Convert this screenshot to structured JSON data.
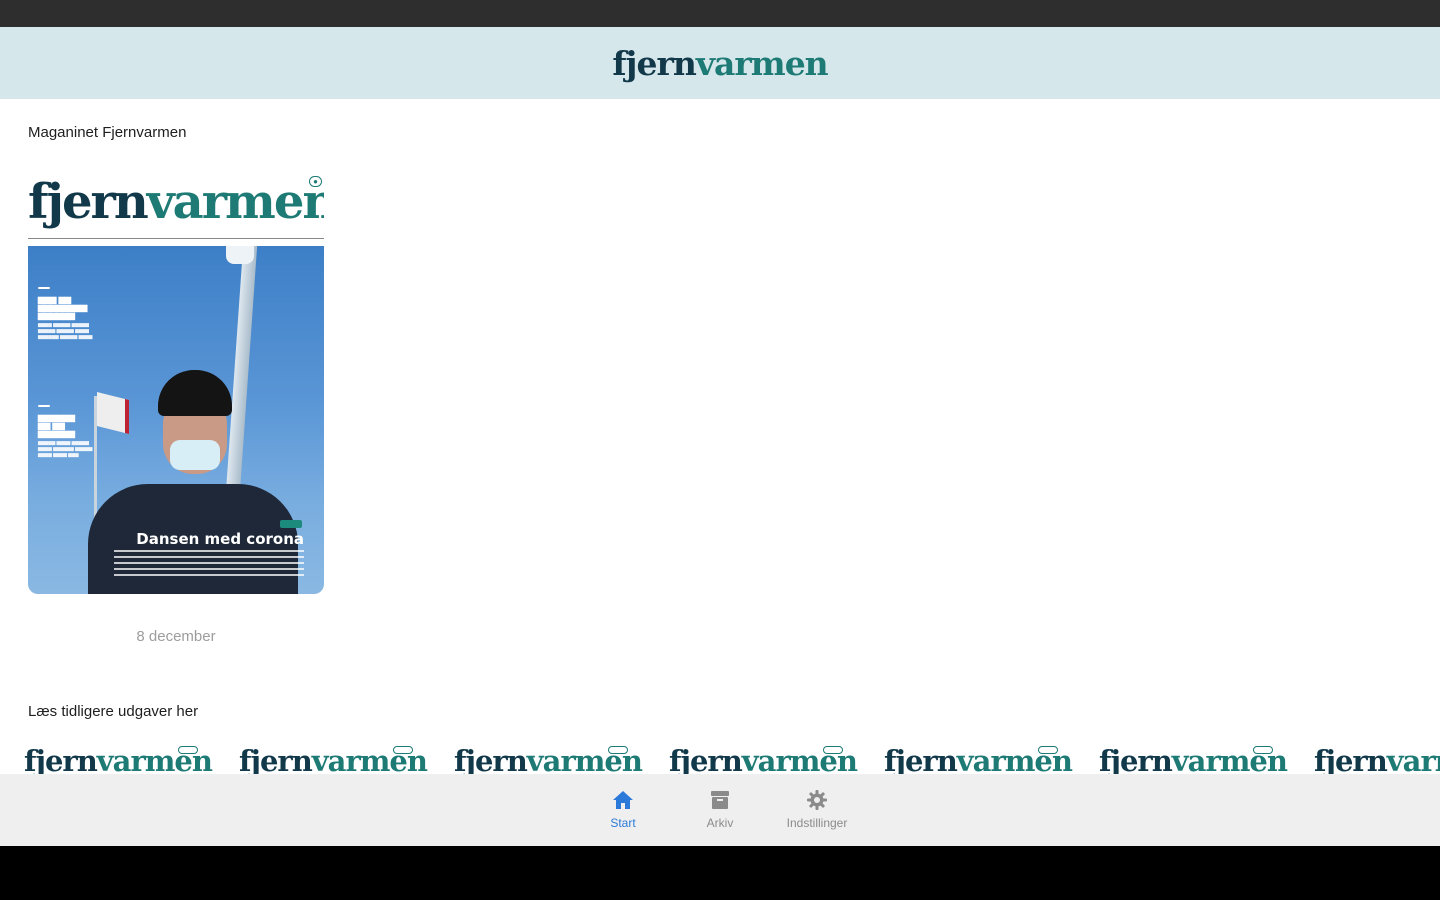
{
  "header": {
    "logo_part1": "fjern",
    "logo_part2": "varmen"
  },
  "section_current": {
    "title": "Maganinet Fjernvarmen"
  },
  "current_issue": {
    "cover_logo_part1": "fjern",
    "cover_logo_part2": "varmen",
    "cover_headline": "Dansen med corona",
    "date": "8 december"
  },
  "section_archive": {
    "title": "Læs tidligere udgaver her"
  },
  "archive_thumbs": [
    {
      "logo_part1": "fjern",
      "logo_part2": "varmen"
    },
    {
      "logo_part1": "fjern",
      "logo_part2": "varmen"
    },
    {
      "logo_part1": "fjern",
      "logo_part2": "varmen"
    },
    {
      "logo_part1": "fjern",
      "logo_part2": "varmen"
    },
    {
      "logo_part1": "fjern",
      "logo_part2": "varmen"
    },
    {
      "logo_part1": "fjern",
      "logo_part2": "varmen"
    },
    {
      "logo_part1": "fjern",
      "logo_part2": "varmen"
    }
  ],
  "bottom_nav": {
    "items": [
      {
        "label": "Start",
        "icon": "home-icon",
        "active": true
      },
      {
        "label": "Arkiv",
        "icon": "archive-icon",
        "active": false
      },
      {
        "label": "Indstillinger",
        "icon": "gear-icon",
        "active": false
      }
    ]
  },
  "colors": {
    "header_bg": "#d6e7ec",
    "logo_dark": "#12394a",
    "logo_teal": "#1d7a74",
    "nav_active": "#2b7ad9",
    "nav_inactive": "#8b8b8b"
  }
}
